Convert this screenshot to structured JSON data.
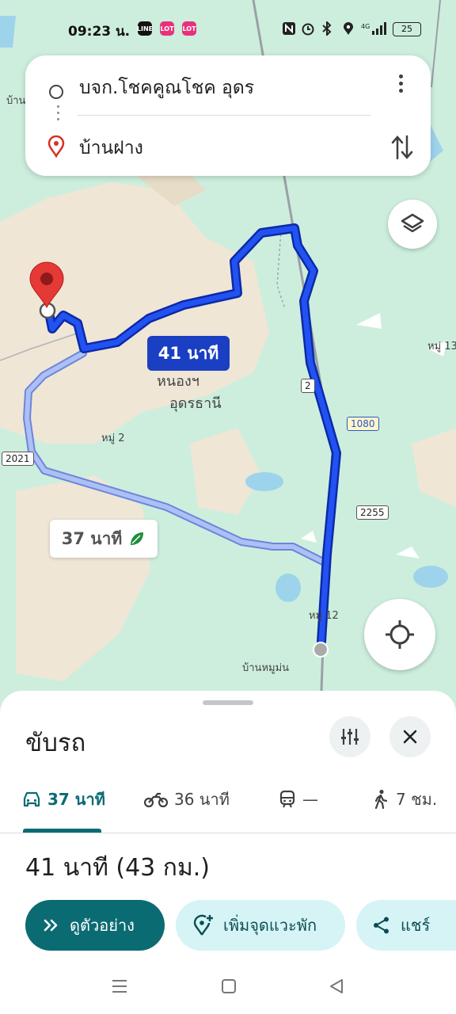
{
  "status_bar": {
    "time": "09:23 น.",
    "app_badges": [
      "LINE",
      "LOT",
      "LOT"
    ],
    "battery": "25"
  },
  "search": {
    "origin": "บจก.โชคคูณโชค อุดร",
    "destination": "บ้านฝาง"
  },
  "map": {
    "route_primary_time": "41 นาที",
    "route_alt_time": "37 นาที",
    "labels": {
      "place_1": "หนองฯ",
      "place_2": "อุดรธานี",
      "village_2": "หมู่ 2",
      "village_12": "หมู่ 12",
      "village_13": "หมู่ 13",
      "village_ban_mu_mon": "บ้านหมูม่น",
      "edge_ban": "บ้าน"
    },
    "road_numbers": {
      "r2": "2",
      "r1080": "1080",
      "r2255": "2255",
      "r2021": "2021"
    },
    "colors": {
      "primary_route": "#1a3fd6",
      "alt_route": "#9fb3ef",
      "pin": "#e53935"
    }
  },
  "sheet": {
    "title": "ขับรถ",
    "modes": [
      {
        "icon": "car-icon",
        "label": "37 นาที"
      },
      {
        "icon": "motorbike-icon",
        "label": "36 นาที"
      },
      {
        "icon": "transit-icon",
        "label": "—"
      },
      {
        "icon": "walk-icon",
        "label": "7 ชม."
      }
    ],
    "summary": "41 นาที (43 กม.)",
    "actions": {
      "preview": "ดูตัวอย่าง",
      "add_stop": "เพิ่มจุดแวะพัก",
      "share": "แชร์"
    }
  }
}
